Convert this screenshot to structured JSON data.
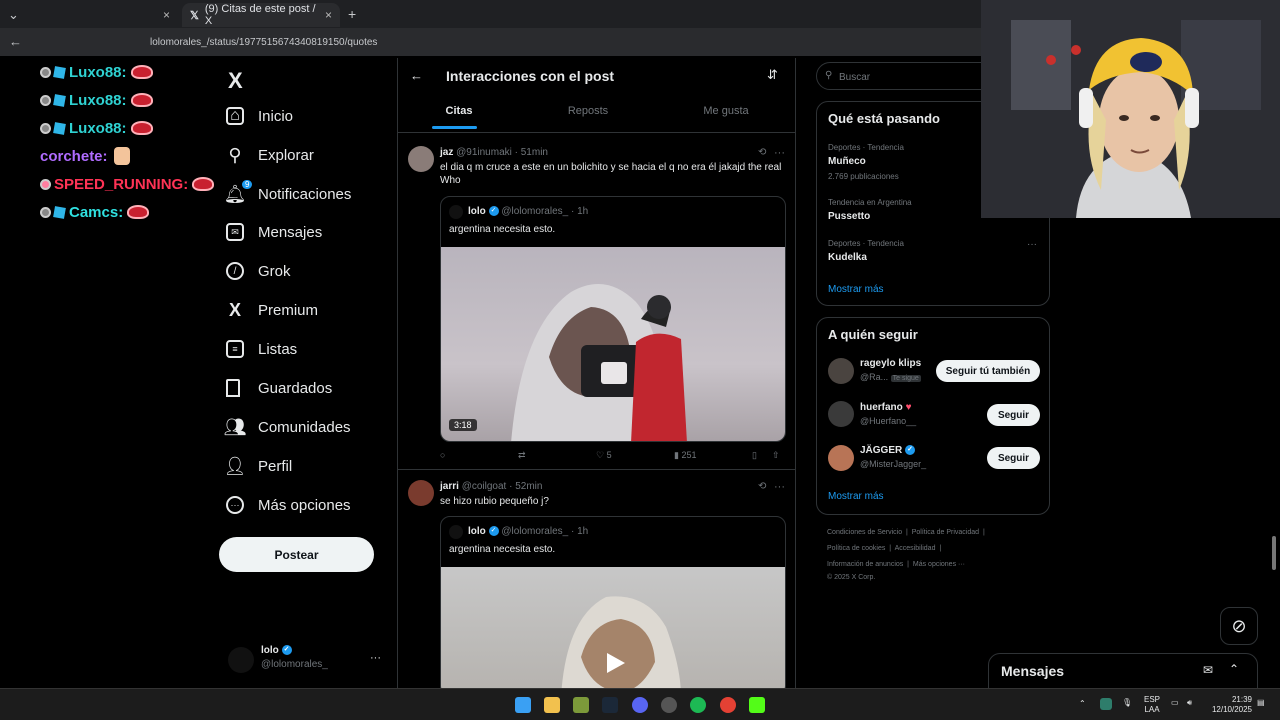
{
  "browser": {
    "tabs": [
      {
        "label": "",
        "close": "×"
      },
      {
        "label": "(9) Citas de este post / X",
        "close": "×"
      }
    ],
    "new_tab": "+",
    "address": "lolomorales_/status/1977515674340819150/quotes"
  },
  "chat": {
    "lines": [
      {
        "user": "Luxo88:",
        "color": "#2fd2d2"
      },
      {
        "user": "Luxo88:",
        "color": "#2fd2d2"
      },
      {
        "user": "Luxo88:",
        "color": "#2fd2d2"
      },
      {
        "user": "corchete:",
        "color": "#b06cff"
      },
      {
        "user": "SPEED_RUNNING:",
        "color": "#ff3355"
      },
      {
        "user": "Camcs:",
        "color": "#2fe0e0"
      }
    ]
  },
  "nav": {
    "logo": "X",
    "items": [
      {
        "label": "Inicio",
        "icon": "home-icon"
      },
      {
        "label": "Explorar",
        "icon": "search-icon"
      },
      {
        "label": "Notificaciones",
        "icon": "bell-icon",
        "badge": "9"
      },
      {
        "label": "Mensajes",
        "icon": "mail-icon"
      },
      {
        "label": "Grok",
        "icon": "grok-icon"
      },
      {
        "label": "Premium",
        "icon": "x-icon"
      },
      {
        "label": "Listas",
        "icon": "list-icon"
      },
      {
        "label": "Guardados",
        "icon": "bookmark-icon"
      },
      {
        "label": "Comunidades",
        "icon": "people-icon"
      },
      {
        "label": "Perfil",
        "icon": "person-icon"
      },
      {
        "label": "Más opciones",
        "icon": "more-circle-icon"
      }
    ],
    "post_button": "Postear",
    "account": {
      "name": "lolo",
      "handle": "@lolomorales_",
      "more": "···"
    }
  },
  "main": {
    "back": "←",
    "title": "Interacciones con el post",
    "filter_icon": "sliders-icon",
    "tabs": [
      "Citas",
      "Reposts",
      "Me gusta"
    ],
    "selected_tab": "Citas",
    "tweets": [
      {
        "name": "jaz",
        "handle": "@91inumaki",
        "time": "· 51min",
        "text": "el dia q m cruce a este en un bolichito y se hacia el q no era él jakajd the real Who",
        "quote": {
          "name": "lolo",
          "handle": "@lolomorales_",
          "time": "· 1h",
          "text": "argentina necesita esto.",
          "video_time": "3:18"
        },
        "actions": {
          "replies": "",
          "reposts": "",
          "likes": "5",
          "views": "251"
        }
      },
      {
        "name": "jarri",
        "handle": "@coilgoat",
        "time": "· 52min",
        "text": "se hizo rubio pequeño j?",
        "quote": {
          "name": "lolo",
          "handle": "@lolomorales_",
          "time": "· 1h",
          "text": "argentina necesita esto."
        }
      }
    ]
  },
  "right": {
    "search_placeholder": "Buscar",
    "trends_title": "Qué está pasando",
    "trends": [
      {
        "meta": "Deportes · Tendencia",
        "name": "Muñeco",
        "count": "2.769 publicaciones"
      },
      {
        "meta": "Tendencia en Argentina",
        "name": "Pussetto",
        "count": ""
      },
      {
        "meta": "Deportes · Tendencia",
        "name": "Kudelka",
        "count": ""
      }
    ],
    "show_more": "Mostrar más",
    "follow_title": "A quién seguir",
    "who_to_follow": [
      {
        "name": "rageylo klips",
        "handle": "@Ra...",
        "tag": "Te sigue",
        "button": "Seguir tú también"
      },
      {
        "name": "huerfano",
        "handle": "@Huerfano__",
        "button": "Seguir"
      },
      {
        "name": "JÄGGER",
        "handle": "@MisterJagger_",
        "button": "Seguir"
      }
    ],
    "footer": [
      [
        "Condiciones de Servicio",
        "|",
        "Política de Privacidad",
        "|"
      ],
      [
        "Política de cookies",
        "|",
        "Accesibilidad",
        "|"
      ],
      [
        "Información de anuncios",
        "|",
        "Más opciones ···"
      ],
      [
        "© 2025 X Corp."
      ]
    ]
  },
  "messages": {
    "label": "Mensajes"
  },
  "taskbar": {
    "lang": "ESP",
    "layout": "LAA",
    "time": "21:39",
    "date": "12/10/2025"
  },
  "colors": {
    "accent": "#1d9bf0",
    "bg": "#000000",
    "border": "#2f3336"
  }
}
